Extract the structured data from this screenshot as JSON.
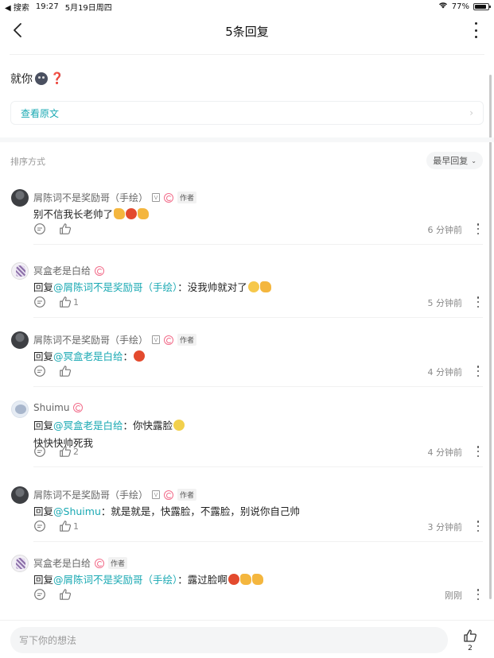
{
  "status_bar": {
    "back_label": "◀ 搜索",
    "time": "19:27",
    "date": "5月19日周四",
    "battery": "77%"
  },
  "nav": {
    "title": "5条回复"
  },
  "original": {
    "text": "就你",
    "view_original": "查看原文"
  },
  "sort": {
    "label": "排序方式",
    "button": "最早回复"
  },
  "comments": [
    {
      "user": "屑陈词不是奖励哥（手绘）",
      "vip": "V",
      "author_tag": "作者",
      "avatar": "a1",
      "reply_prefix": "",
      "mention": "",
      "text": "别不信我长老帅了",
      "line2": "",
      "likes": "",
      "time": "6 分钟前"
    },
    {
      "user": "冥盒老是白给",
      "vip": "",
      "author_tag": "",
      "avatar": "a2",
      "reply_prefix": "回复",
      "mention": "@屑陈词不是奖励哥（手绘）",
      "text": "：没我帅就对了",
      "line2": "",
      "likes": "1",
      "time": "5 分钟前"
    },
    {
      "user": "屑陈词不是奖励哥（手绘）",
      "vip": "V",
      "author_tag": "作者",
      "avatar": "a1",
      "reply_prefix": "回复",
      "mention": "@冥盒老是白给",
      "text": "：",
      "line2": "",
      "likes": "",
      "time": "4 分钟前"
    },
    {
      "user": "Shuimu",
      "vip": "",
      "author_tag": "",
      "avatar": "a3",
      "reply_prefix": "回复",
      "mention": "@冥盒老是白给",
      "text": "：你快露脸",
      "line2": "快快快帅死我",
      "likes": "2",
      "time": "4 分钟前"
    },
    {
      "user": "屑陈词不是奖励哥（手绘）",
      "vip": "V",
      "author_tag": "作者",
      "avatar": "a1",
      "reply_prefix": "回复",
      "mention": "@Shuimu",
      "text": "：就是就是，快露脸，不露脸，别说你自己帅",
      "line2": "",
      "likes": "1",
      "time": "3 分钟前"
    },
    {
      "user": "冥盒老是白给",
      "vip": "",
      "author_tag": "作者",
      "avatar": "a2",
      "reply_prefix": "回复",
      "mention": "@屑陈词不是奖励哥（手绘）",
      "text": "：露过脸啊",
      "line2": "",
      "likes": "",
      "time": "刚刚"
    }
  ],
  "bottom": {
    "placeholder": "写下你的想法",
    "like_count": "2"
  },
  "colors": {
    "accent": "#1aa9b3",
    "level": "#f26c8a"
  },
  "icons": [
    "back-arrow-icon",
    "more-vertical-icon",
    "reply-bubble-icon",
    "thumbs-up-icon",
    "wifi-icon",
    "battery-icon"
  ]
}
